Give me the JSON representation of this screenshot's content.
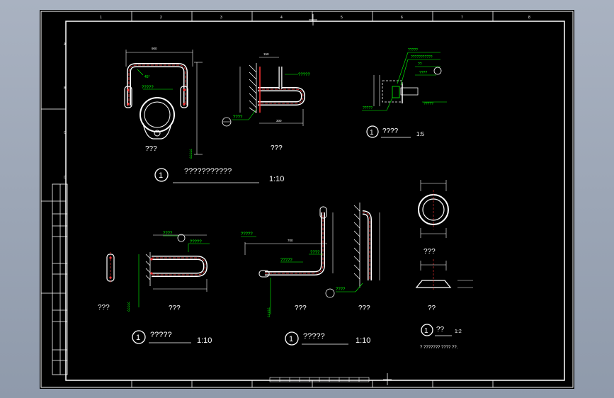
{
  "labels": {
    "q1": "???",
    "q2": "???",
    "q_dim_small": "?????",
    "q_long": "???????????",
    "q4": "????",
    "q5": "?????",
    "q6": "??",
    "q_small2": "????",
    "q_note": "? ??????? ???? ??.",
    "q_dim_mm": "???"
  },
  "sections": {
    "top_title": "???????????",
    "top_scale": "1:10",
    "detail_title": "????",
    "detail_scale": "1:5",
    "left_bottom_title": "?????",
    "left_bottom_scale": "1:10",
    "mid_bottom_title": "?????",
    "mid_bottom_scale": "1:10",
    "right_bottom_title": "??",
    "right_bottom_scale": "1:2",
    "marker": "1"
  },
  "grid": {
    "top": [
      "1",
      "2",
      "3",
      "4",
      "5",
      "6",
      "7",
      "8"
    ],
    "left": [
      "A",
      "B",
      "C",
      "D"
    ]
  },
  "colors": {
    "background": "#000000",
    "frame": "#ffffff",
    "rail": "#ff3333",
    "annotation": "#00ff00",
    "text": "#ffffff"
  }
}
